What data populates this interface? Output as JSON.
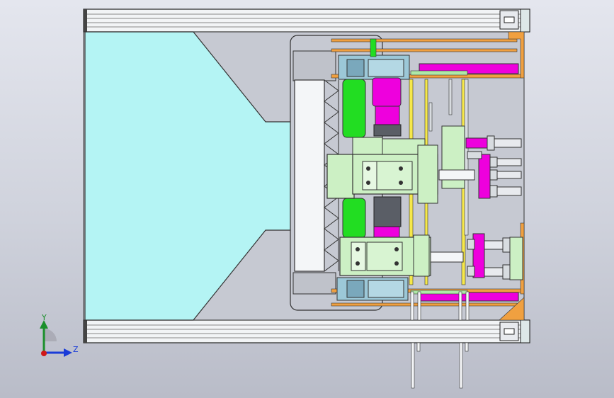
{
  "viewport": {
    "triad": {
      "x_label": "",
      "y_label": "Y",
      "z_label": "Z",
      "y_color": "#1a8f2a",
      "z_color": "#1a3cd8",
      "x_color": "#d01818"
    }
  },
  "colors": {
    "frame": "#f2f4f6",
    "cyan_plate": "#b4f4f4",
    "grey_plate": "#c6c9d2",
    "orange_rail": "#f0a040",
    "magenta": "#ee00dd",
    "green": "#22dd22",
    "light_green": "#ccf0c4",
    "steel_blue": "#9cc8d8",
    "dark_grey": "#5a5e66"
  }
}
